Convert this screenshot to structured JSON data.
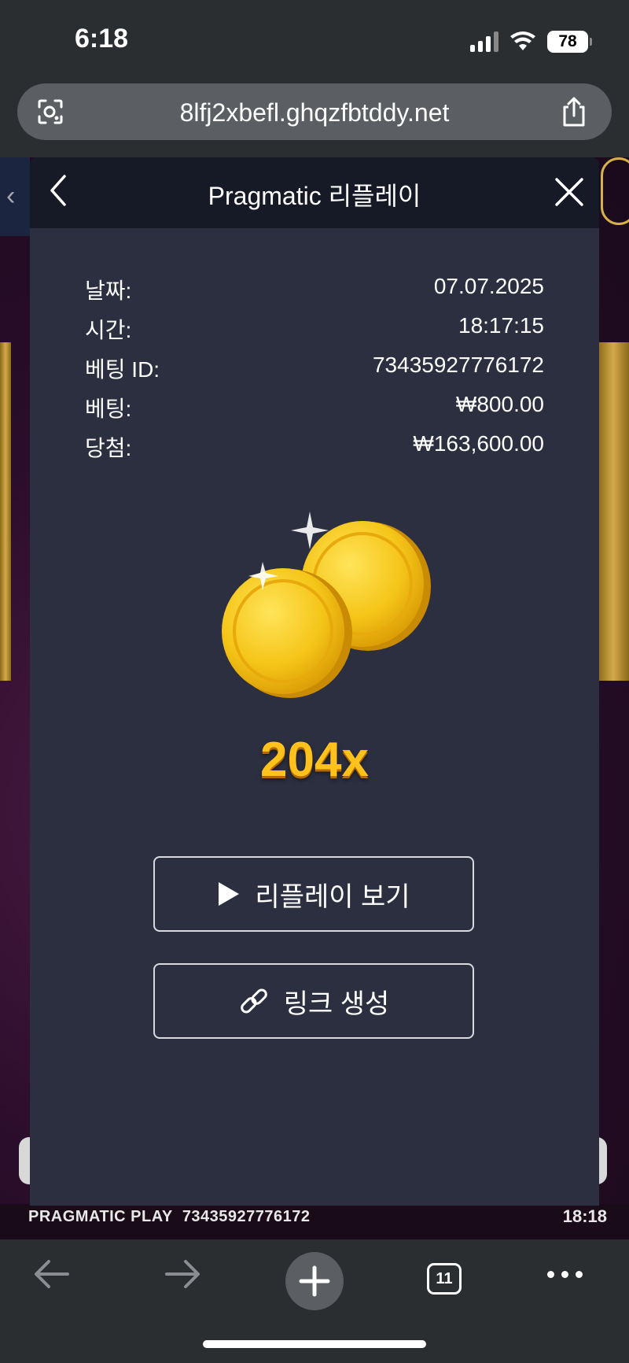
{
  "status_bar": {
    "time": "6:18",
    "battery": "78"
  },
  "browser": {
    "url": "8lfj2xbefl.ghqzfbtddy.net",
    "tab_count": "11"
  },
  "game": {
    "brand_text": "PRAGMATIC PLAY",
    "bet_id": "73435927776172",
    "clock": "18:18"
  },
  "modal": {
    "title": "Pragmatic 리플레이",
    "info": [
      {
        "label": "날짜:",
        "value": "07.07.2025"
      },
      {
        "label": "시간:",
        "value": "18:17:15"
      },
      {
        "label": "베팅 ID:",
        "value": "73435927776172"
      },
      {
        "label": "베팅:",
        "value": "₩800.00"
      },
      {
        "label": "당첨:",
        "value": "₩163,600.00"
      }
    ],
    "multiplier": "204x",
    "watch_replay_label": "리플레이 보기",
    "create_link_label": "링크 생성"
  },
  "colors": {
    "modal_bg": "#2c2f3f",
    "header_bg": "#161926",
    "multiplier": "#ffc21c",
    "coin": "#f5c518"
  }
}
